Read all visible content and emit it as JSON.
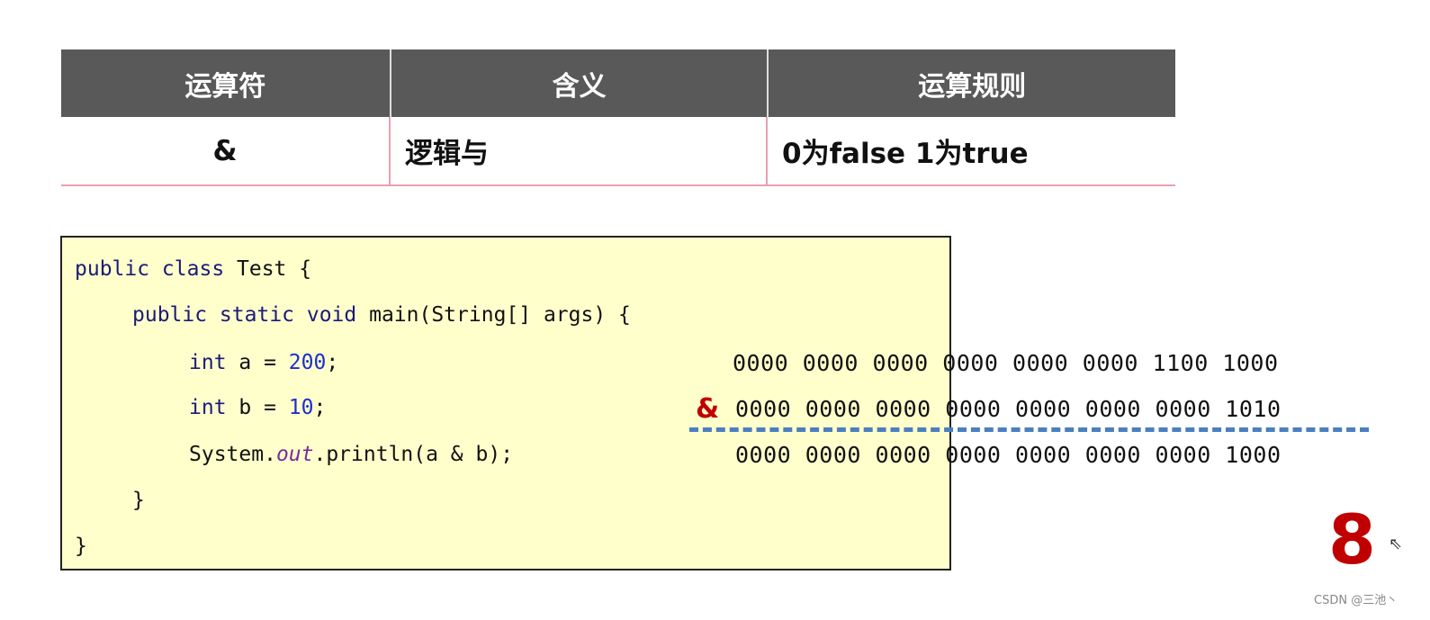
{
  "table": {
    "headers": [
      "运算符",
      "含义",
      "运算规则"
    ],
    "row": [
      "&",
      "逻辑与",
      "0为false 1为true"
    ]
  },
  "code": {
    "l1_kw": "public class",
    "l1_rest": " Test {",
    "l2_kw": "public static void",
    "l2_rest": " main(String[] args) {",
    "l3_kw": "int",
    "l3_mid": " a = ",
    "l3_num": "200",
    "l3_end": ";",
    "l4_kw": "int",
    "l4_mid": " b = ",
    "l4_num": "10",
    "l4_end": ";",
    "l5_a": "System.",
    "l5_field": "out",
    "l5_b": ".println(a & b);",
    "l6": "}",
    "l7": "}"
  },
  "binary": {
    "a": "0000 0000 0000 0000 0000 0000 1100 1000",
    "operator": "&",
    "b": "0000 0000 0000 0000 0000 0000 0000 1010",
    "result": "0000 0000 0000 0000 0000 0000 0000 1000",
    "decimal_result": "8"
  },
  "watermark": "CSDN @三池丶",
  "colors": {
    "header_bg": "#595959",
    "accent_red": "#c00000",
    "divider_blue": "#4a7fc0",
    "code_bg": "#ffffcc"
  }
}
